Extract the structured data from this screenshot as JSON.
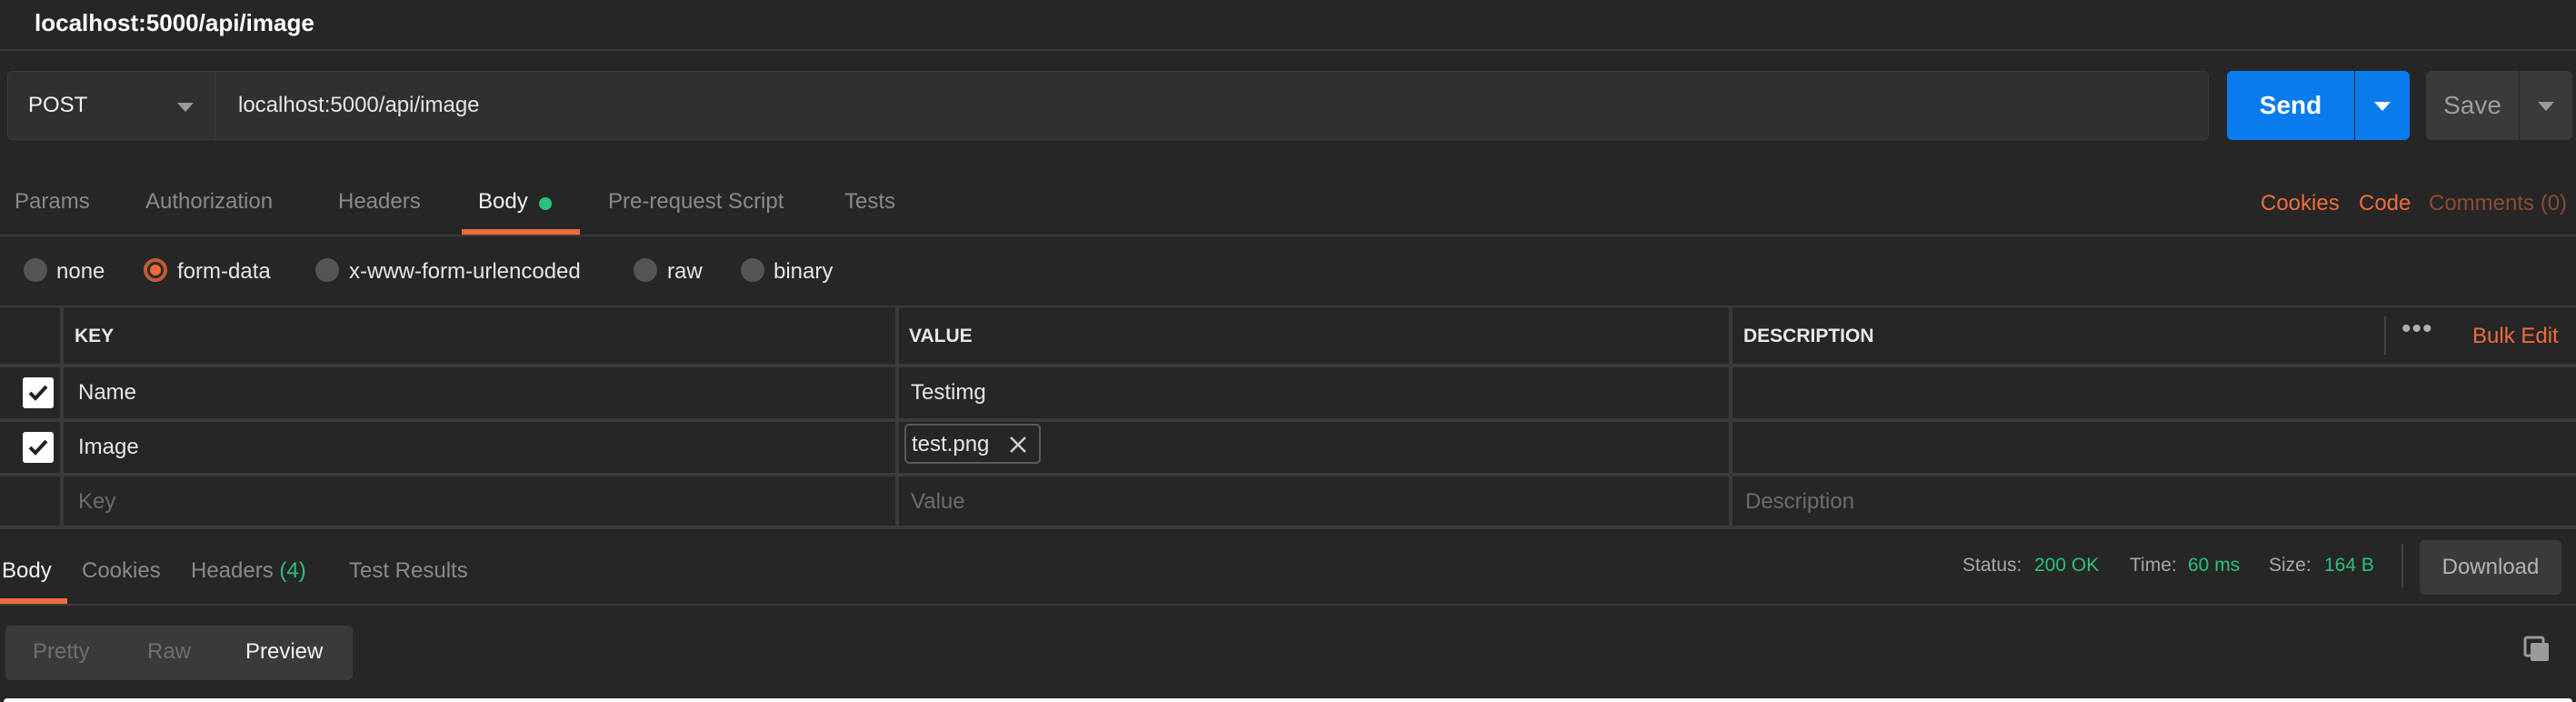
{
  "window": {
    "title": "localhost:5000/api/image"
  },
  "request": {
    "method": "POST",
    "url": "localhost:5000/api/image",
    "send_label": "Send",
    "save_label": "Save"
  },
  "request_tabs": [
    {
      "label": "Params",
      "active": false
    },
    {
      "label": "Authorization",
      "active": false
    },
    {
      "label": "Headers",
      "active": false
    },
    {
      "label": "Body",
      "active": true,
      "indicator": "green-dot"
    },
    {
      "label": "Pre-request Script",
      "active": false
    },
    {
      "label": "Tests",
      "active": false
    }
  ],
  "request_links": {
    "cookies": "Cookies",
    "code": "Code",
    "comments": "Comments (0)"
  },
  "body_types": [
    {
      "label": "none",
      "selected": false
    },
    {
      "label": "form-data",
      "selected": true
    },
    {
      "label": "x-www-form-urlencoded",
      "selected": false
    },
    {
      "label": "raw",
      "selected": false
    },
    {
      "label": "binary",
      "selected": false
    }
  ],
  "kv_table": {
    "headers": {
      "key": "KEY",
      "value": "VALUE",
      "description": "DESCRIPTION"
    },
    "bulk_edit": "Bulk Edit",
    "more_icon": "ellipsis-icon",
    "rows": [
      {
        "checked": true,
        "key": "Name",
        "value": "Testimg",
        "description": ""
      },
      {
        "checked": true,
        "key": "Image",
        "value": "test.png",
        "value_type": "file",
        "description": ""
      }
    ],
    "placeholders": {
      "key": "Key",
      "value": "Value",
      "description": "Description"
    }
  },
  "response": {
    "tabs": [
      {
        "label": "Body",
        "active": true
      },
      {
        "label": "Cookies",
        "active": false
      },
      {
        "label": "Headers",
        "active": false,
        "count": "(4)"
      },
      {
        "label": "Test Results",
        "active": false
      }
    ],
    "status": {
      "label": "Status:",
      "value": "200 OK"
    },
    "time": {
      "label": "Time:",
      "value": "60 ms"
    },
    "size": {
      "label": "Size:",
      "value": "164 B"
    },
    "download_label": "Download",
    "view_modes": [
      {
        "label": "Pretty",
        "active": false
      },
      {
        "label": "Raw",
        "active": false
      },
      {
        "label": "Preview",
        "active": true
      }
    ],
    "copy_icon": "copy-icon"
  },
  "colors": {
    "accent": "#f26b3a",
    "primary_button": "#097bed",
    "success": "#27c27d",
    "background": "#262626"
  }
}
